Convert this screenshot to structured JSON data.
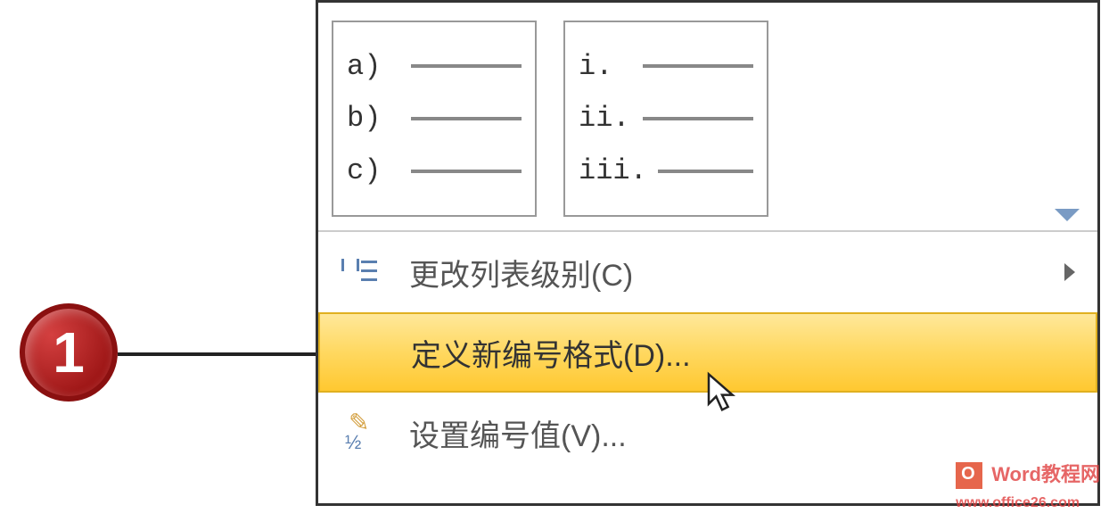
{
  "callout": {
    "number": "1"
  },
  "gallery": {
    "option1": {
      "line1": "a)",
      "line2": "b)",
      "line3": "c)"
    },
    "option2": {
      "line1": "i.",
      "line2": "ii.",
      "line3": "iii."
    }
  },
  "menu": {
    "change_level": "更改列表级别(C)",
    "define_new": "定义新编号格式(D)...",
    "set_value": "设置编号值(V)..."
  },
  "watermark": {
    "text": "Word教程网",
    "url": "www.office26.com"
  }
}
